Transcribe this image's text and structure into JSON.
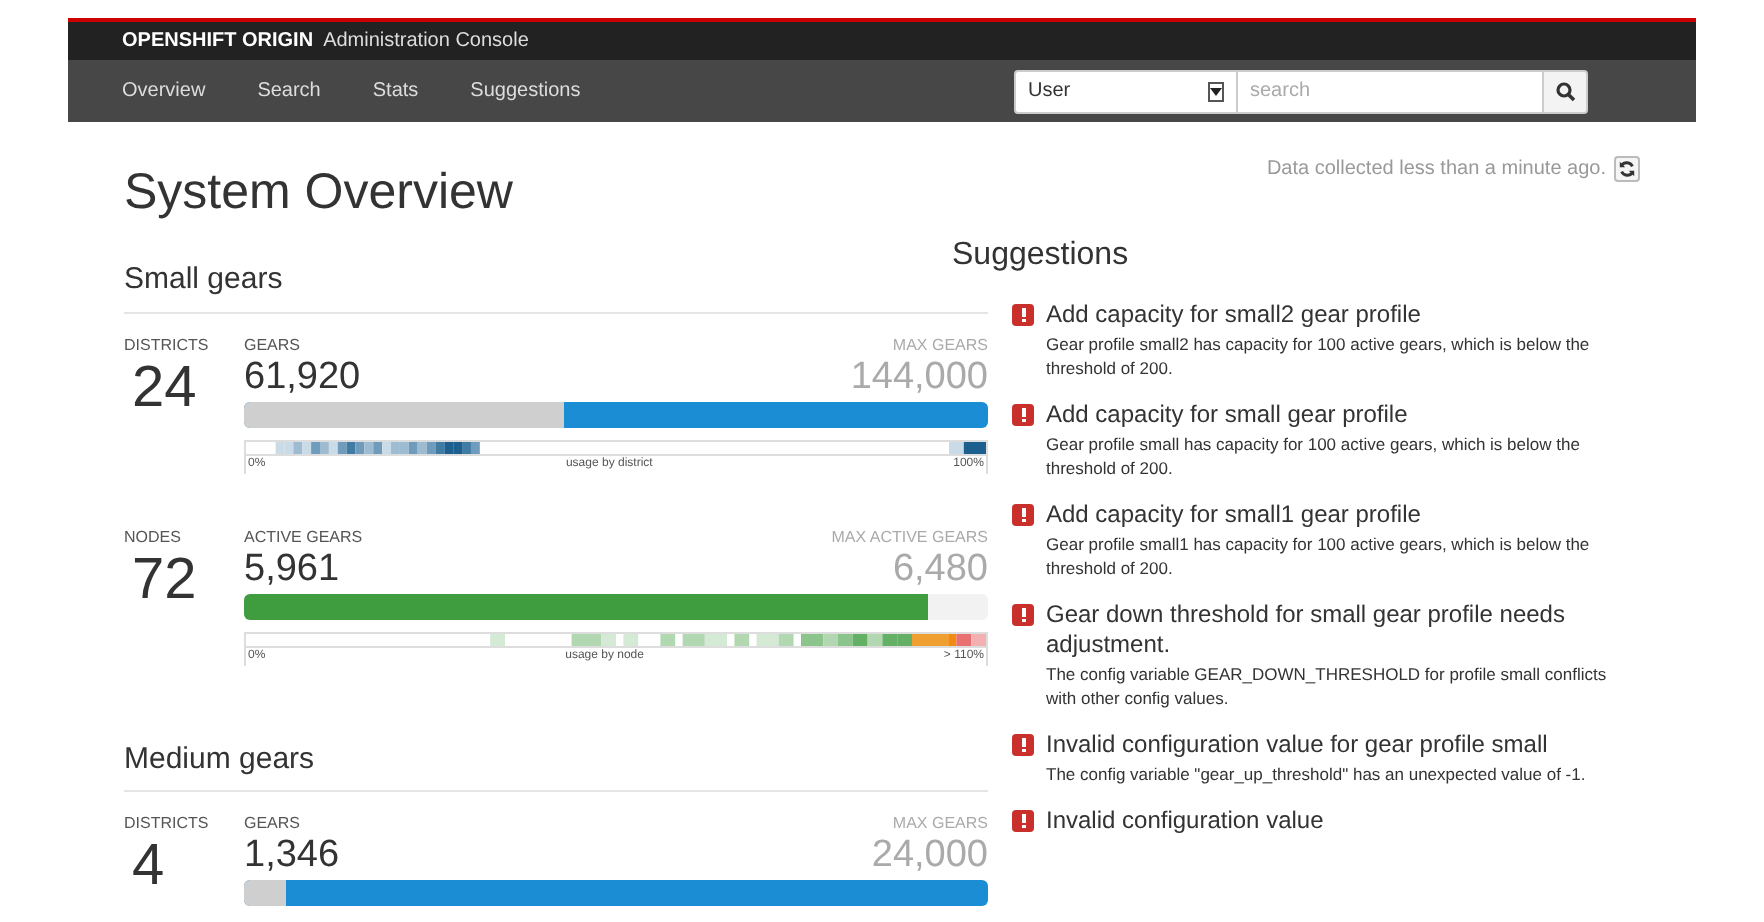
{
  "header": {
    "brand": "OPENSHIFT ORIGIN",
    "subtitle": "Administration Console"
  },
  "nav": [
    {
      "label": "Overview"
    },
    {
      "label": "Search"
    },
    {
      "label": "Stats"
    },
    {
      "label": "Suggestions"
    }
  ],
  "search": {
    "scope": "User",
    "placeholder": "search"
  },
  "page_title": "System Overview",
  "collected": "Data collected less than a minute ago.",
  "sections": [
    {
      "title": "Small gears",
      "rows": [
        {
          "kind": "gears",
          "count_label": "DISTRICTS",
          "count": "24",
          "used_label": "GEARS",
          "used": "61,920",
          "max_label": "MAX GEARS",
          "max": "144,000",
          "level": 0.43,
          "scale_min": "0%",
          "scale_caption": "usage by district",
          "scale_max": "100%"
        },
        {
          "kind": "active",
          "count_label": "NODES",
          "count": "72",
          "used_label": "ACTIVE GEARS",
          "used": "5,961",
          "max_label": "MAX ACTIVE GEARS",
          "max": "6,480",
          "level": 0.92,
          "scale_min": "0%",
          "scale_caption": "usage by node",
          "scale_max": "> 110%"
        }
      ]
    },
    {
      "title": "Medium gears",
      "rows": [
        {
          "kind": "gears",
          "count_label": "DISTRICTS",
          "count": "4",
          "used_label": "GEARS",
          "used": "1,346",
          "max_label": "MAX GEARS",
          "max": "24,000",
          "level": 0.056
        }
      ]
    }
  ],
  "suggestions": {
    "title": "Suggestions",
    "items": [
      {
        "title": "Add capacity for small2 gear profile",
        "detail": "Gear profile small2 has capacity for 100 active gears, which is below the threshold of 200."
      },
      {
        "title": "Add capacity for small gear profile",
        "detail": "Gear profile small has capacity for 100 active gears, which is below the threshold of 200."
      },
      {
        "title": "Add capacity for small1 gear profile",
        "detail": "Gear profile small1 has capacity for 100 active gears, which is below the threshold of 200."
      },
      {
        "title": "Gear down threshold for small gear profile needs adjustment.",
        "detail": "The config variable GEAR_DOWN_THRESHOLD for profile small conflicts with other config values."
      },
      {
        "title": "Invalid configuration value for gear profile small",
        "detail": "The config variable \"gear_up_threshold\" has an unexpected value of -1."
      },
      {
        "title": "Invalid configuration value"
      }
    ]
  }
}
